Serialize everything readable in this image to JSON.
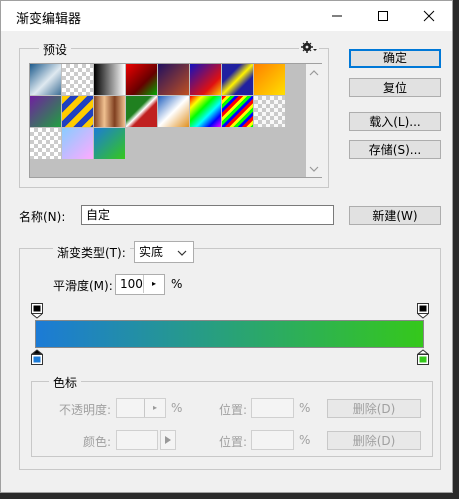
{
  "window": {
    "title": "渐变编辑器"
  },
  "presets": {
    "label": "预设",
    "swatches": [
      "linear-gradient(135deg,#1c5a8c,#dfe9f0 55%,#3e6f96)",
      "checker",
      "linear-gradient(90deg,#000,#fff)",
      "linear-gradient(135deg,#e00,#600 60%,#0a0)",
      "linear-gradient(135deg,#201060,#c05020)",
      "linear-gradient(135deg,#1010c0,#e01010 70%,#ffd000)",
      "linear-gradient(135deg,#2020a0 30%,#fff200 50%,#2020a0 70%)",
      "linear-gradient(135deg,#ff8000,#ffe000)",
      "linear-gradient(135deg,#7020a0,#20a040)",
      "repeating-linear-gradient(135deg,#ffcc00 0 6px,#2040c0 6px 12px)",
      "linear-gradient(90deg,#804020,#f0c090,#804020,#f0c090)",
      "linear-gradient(135deg,#208020 40%,#fff 50%,#c02020 60%)",
      "linear-gradient(135deg,#2060c0,#fff 50%,#e09020)",
      "linear-gradient(135deg,#f00,#ff0,#0f0,#0ff,#00f,#f0f)",
      "repeating-linear-gradient(135deg,#f00 0 3px,#ff0 3px 6px,#0f0 6px 9px,#00f 9px 12px)",
      "checker-white",
      "checker",
      "linear-gradient(135deg,#8cf,#faf)",
      "linear-gradient(135deg,#1c7bd6,#35c81b)"
    ]
  },
  "buttons": {
    "ok": "确定",
    "reset": "复位",
    "load": "载入(L)...",
    "save": "存储(S)...",
    "new": "新建(W)"
  },
  "name": {
    "label": "名称(N):",
    "value": "自定"
  },
  "gradient_type": {
    "label": "渐变类型(T):",
    "value": "实底"
  },
  "smoothness": {
    "label": "平滑度(M):",
    "value": "100",
    "unit": "%"
  },
  "gradient": {
    "start_color": "#1c7bd6",
    "end_color": "#35c81b"
  },
  "color_stops": {
    "label": "色标",
    "opacity_label": "不透明度:",
    "opacity_unit": "%",
    "color_label": "颜色:",
    "location_label": "位置:",
    "location_unit": "%",
    "delete_label": "删除(D)"
  }
}
